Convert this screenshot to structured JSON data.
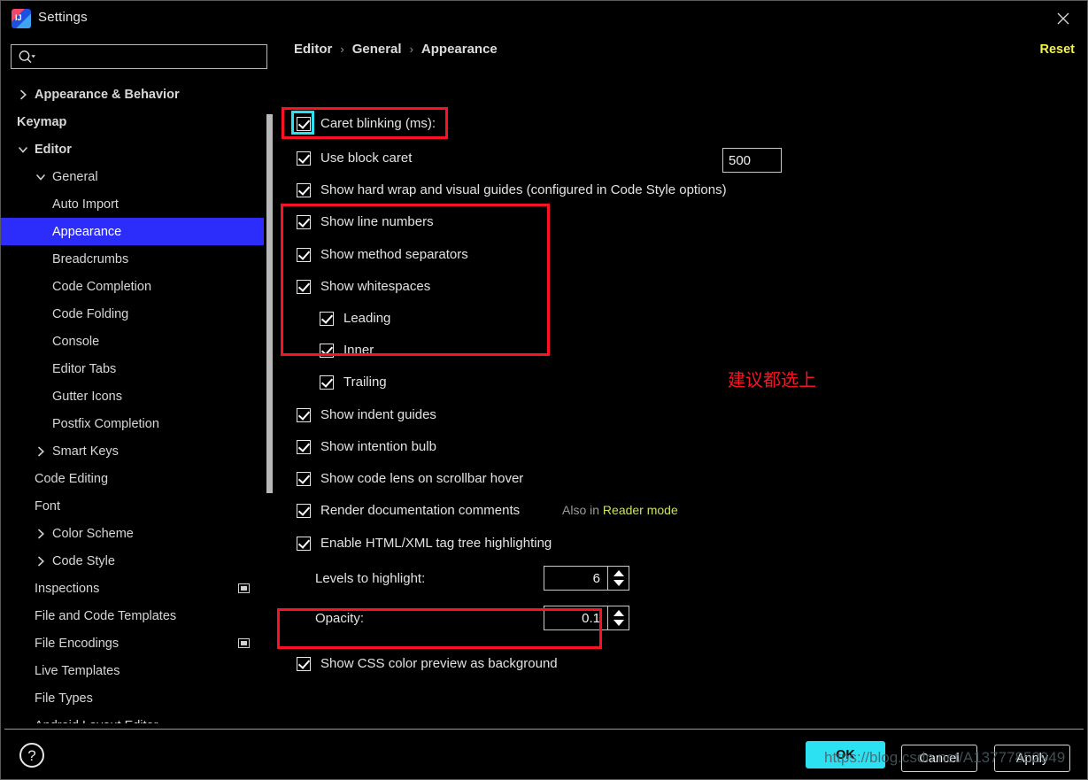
{
  "window": {
    "title": "Settings",
    "app_icon": "intellij-idea-icon",
    "close_icon": "close-icon"
  },
  "sidebar": {
    "search": {
      "placeholder": "",
      "value": "",
      "icon": "search-icon"
    },
    "items": [
      {
        "label": "Appearance & Behavior",
        "level": 0,
        "arrow": "collapsed",
        "bold": true,
        "selected": false,
        "scope_icon": false
      },
      {
        "label": "Keymap",
        "level": 0,
        "arrow": "none",
        "bold": true,
        "selected": false,
        "scope_icon": false
      },
      {
        "label": "Editor",
        "level": 0,
        "arrow": "expanded",
        "bold": true,
        "selected": false,
        "scope_icon": false
      },
      {
        "label": "General",
        "level": 1,
        "arrow": "expanded",
        "bold": false,
        "selected": false,
        "scope_icon": false
      },
      {
        "label": "Auto Import",
        "level": 2,
        "arrow": "none",
        "bold": false,
        "selected": false,
        "scope_icon": false
      },
      {
        "label": "Appearance",
        "level": 2,
        "arrow": "none",
        "bold": false,
        "selected": true,
        "scope_icon": false
      },
      {
        "label": "Breadcrumbs",
        "level": 2,
        "arrow": "none",
        "bold": false,
        "selected": false,
        "scope_icon": false
      },
      {
        "label": "Code Completion",
        "level": 2,
        "arrow": "none",
        "bold": false,
        "selected": false,
        "scope_icon": false
      },
      {
        "label": "Code Folding",
        "level": 2,
        "arrow": "none",
        "bold": false,
        "selected": false,
        "scope_icon": false
      },
      {
        "label": "Console",
        "level": 2,
        "arrow": "none",
        "bold": false,
        "selected": false,
        "scope_icon": false
      },
      {
        "label": "Editor Tabs",
        "level": 2,
        "arrow": "none",
        "bold": false,
        "selected": false,
        "scope_icon": false
      },
      {
        "label": "Gutter Icons",
        "level": 2,
        "arrow": "none",
        "bold": false,
        "selected": false,
        "scope_icon": false
      },
      {
        "label": "Postfix Completion",
        "level": 2,
        "arrow": "none",
        "bold": false,
        "selected": false,
        "scope_icon": false
      },
      {
        "label": "Smart Keys",
        "level": 1,
        "arrow": "collapsed",
        "bold": false,
        "selected": false,
        "scope_icon": false
      },
      {
        "label": "Code Editing",
        "level": 1,
        "arrow": "none",
        "bold": false,
        "selected": false,
        "scope_icon": false
      },
      {
        "label": "Font",
        "level": 1,
        "arrow": "none",
        "bold": false,
        "selected": false,
        "scope_icon": false
      },
      {
        "label": "Color Scheme",
        "level": 1,
        "arrow": "collapsed",
        "bold": false,
        "selected": false,
        "scope_icon": false
      },
      {
        "label": "Code Style",
        "level": 1,
        "arrow": "collapsed",
        "bold": false,
        "selected": false,
        "scope_icon": false
      },
      {
        "label": "Inspections",
        "level": 1,
        "arrow": "none",
        "bold": false,
        "selected": false,
        "scope_icon": true
      },
      {
        "label": "File and Code Templates",
        "level": 1,
        "arrow": "none",
        "bold": false,
        "selected": false,
        "scope_icon": false
      },
      {
        "label": "File Encodings",
        "level": 1,
        "arrow": "none",
        "bold": false,
        "selected": false,
        "scope_icon": true
      },
      {
        "label": "Live Templates",
        "level": 1,
        "arrow": "none",
        "bold": false,
        "selected": false,
        "scope_icon": false
      },
      {
        "label": "File Types",
        "level": 1,
        "arrow": "none",
        "bold": false,
        "selected": false,
        "scope_icon": false
      },
      {
        "label": "Android Layout Editor",
        "level": 1,
        "arrow": "none",
        "bold": false,
        "selected": false,
        "scope_icon": false
      }
    ]
  },
  "breadcrumb": {
    "parts": [
      "Editor",
      "General",
      "Appearance"
    ],
    "separator": "›"
  },
  "header": {
    "reset_label": "Reset"
  },
  "settings": {
    "caret_blinking": {
      "label": "Caret blinking (ms):",
      "checked": true,
      "value": "500"
    },
    "options": [
      {
        "label": "Use block caret",
        "checked": true
      },
      {
        "label": "Show hard wrap and visual guides (configured in Code Style options)",
        "checked": true
      },
      {
        "label": "Show line numbers",
        "checked": true
      },
      {
        "label": "Show method separators",
        "checked": true
      },
      {
        "label": "Show whitespaces",
        "checked": true
      },
      {
        "label": "Leading",
        "checked": true
      },
      {
        "label": "Inner",
        "checked": true
      },
      {
        "label": "Trailing",
        "checked": true
      },
      {
        "label": "Show indent guides",
        "checked": true
      },
      {
        "label": "Show intention bulb",
        "checked": true
      },
      {
        "label": "Show code lens on scrollbar hover",
        "checked": true
      },
      {
        "label": "Render documentation comments",
        "checked": true
      },
      {
        "label": "Enable HTML/XML tag tree highlighting",
        "checked": true
      },
      {
        "label": "Show CSS color preview as background",
        "checked": true
      }
    ],
    "also_in_prefix": "Also in ",
    "reader_mode_link": "Reader mode",
    "levels_to_highlight": {
      "label": "Levels to highlight:",
      "value": "6"
    },
    "opacity": {
      "label": "Opacity:",
      "value": "0.1"
    }
  },
  "annotations": {
    "chinese_note": "建议都选上",
    "red_color": "#fc1225",
    "cyan_color": "#2ce1f2"
  },
  "footer": {
    "help_label": "?",
    "ok_label": "OK",
    "cancel_label": "Cancel",
    "apply_label": "Apply",
    "watermark": "https://blog.csdn.net/A13777852949"
  },
  "colors": {
    "selection_blue": "#2d2dfb",
    "reset_yellow": "#f3f24a",
    "link_green": "#c9e265",
    "ok_cyan": "#2ce1f2"
  }
}
